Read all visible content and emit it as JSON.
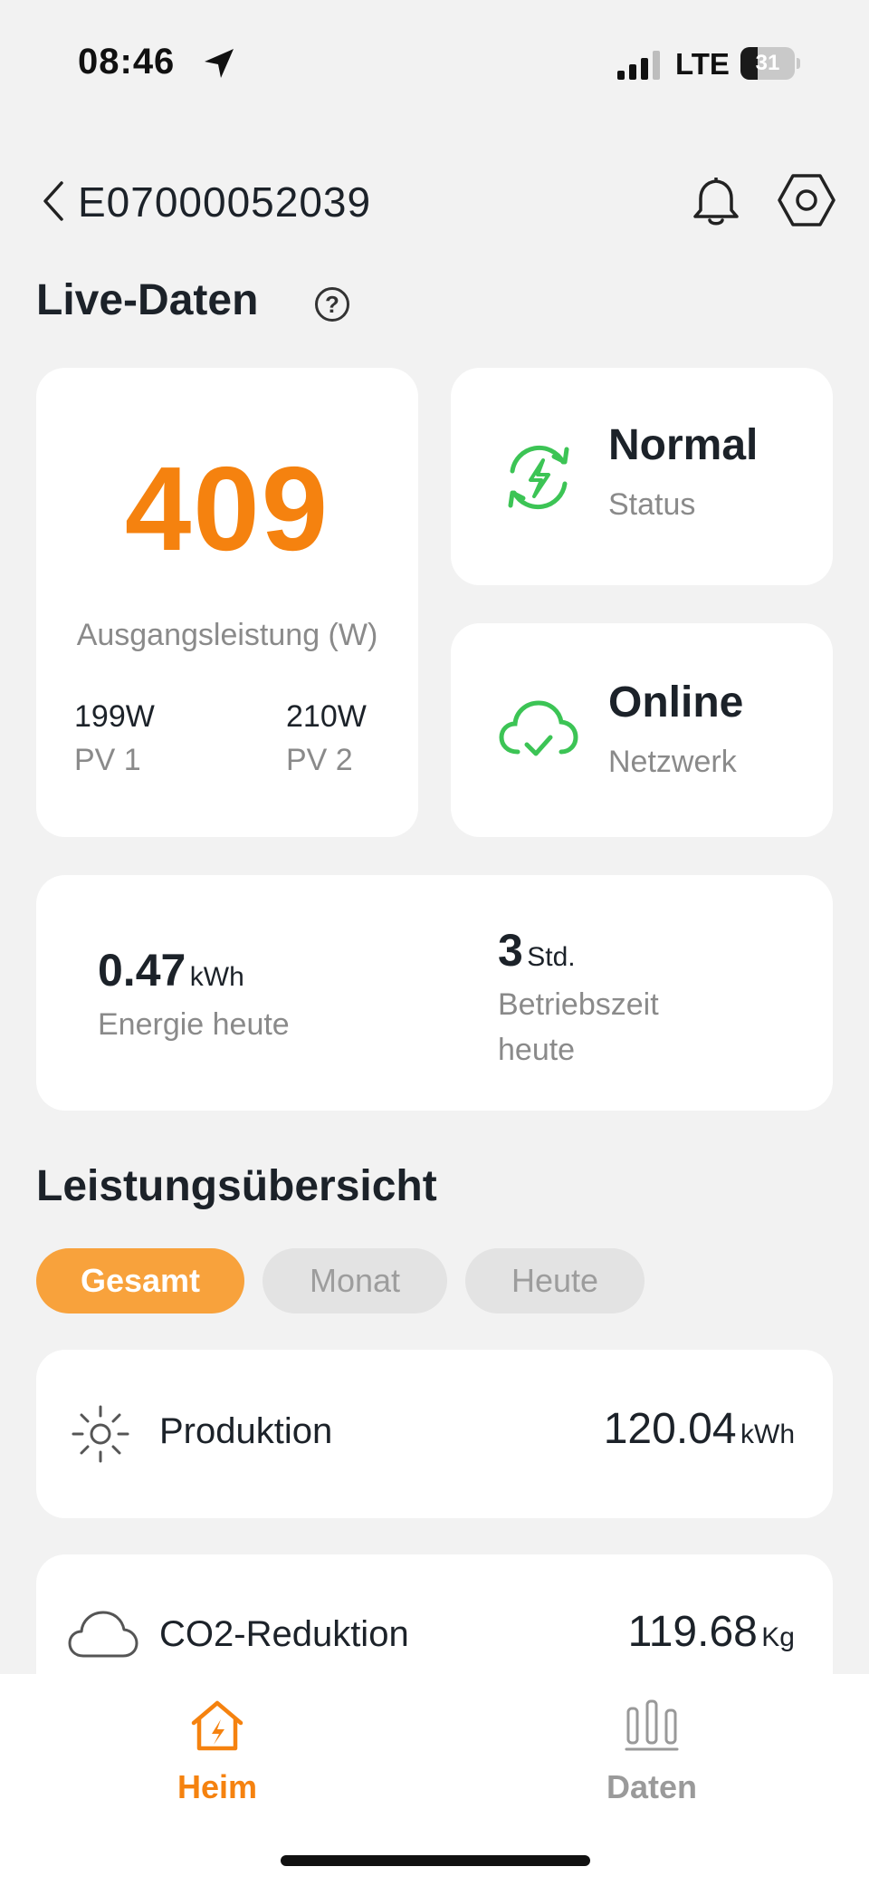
{
  "status_bar": {
    "time": "08:46",
    "network": "LTE",
    "battery_level": "31",
    "battery_fraction": 0.31
  },
  "header": {
    "device_id": "E07000052039"
  },
  "live": {
    "title": "Live-Daten",
    "help_glyph": "?",
    "output_power": "409",
    "output_label": "Ausgangsleistung (W)",
    "pv1_value": "199W",
    "pv1_label": "PV 1",
    "pv2_value": "210W",
    "pv2_label": "PV 2",
    "status_value": "Normal",
    "status_label": "Status",
    "network_value": "Online",
    "network_label": "Netzwerk",
    "energy_value": "0.47",
    "energy_unit": "kWh",
    "energy_label": "Energie heute",
    "runtime_value": "3",
    "runtime_unit": "Std.",
    "runtime_label_1": "Betriebszeit",
    "runtime_label_2": "heute"
  },
  "overview": {
    "title": "Leistungsübersicht",
    "tabs": [
      {
        "label": "Gesamt",
        "active": true
      },
      {
        "label": "Monat",
        "active": false
      },
      {
        "label": "Heute",
        "active": false
      }
    ],
    "rows": [
      {
        "label": "Produktion",
        "value": "120.04",
        "unit": "kWh",
        "icon": "sun-icon"
      },
      {
        "label": "CO2-Reduktion",
        "value": "119.68",
        "unit": "Kg",
        "icon": "cloud-icon"
      }
    ]
  },
  "nav": {
    "items": [
      {
        "label": "Heim",
        "icon": "home-energy-icon",
        "active": true
      },
      {
        "label": "Daten",
        "icon": "bar-chart-icon",
        "active": false
      }
    ]
  },
  "colors": {
    "accent": "#f5820f",
    "pill_active": "#f8a23c",
    "success": "#3cc455",
    "muted_text": "#8a8a8a",
    "background": "#f2f2f2"
  }
}
